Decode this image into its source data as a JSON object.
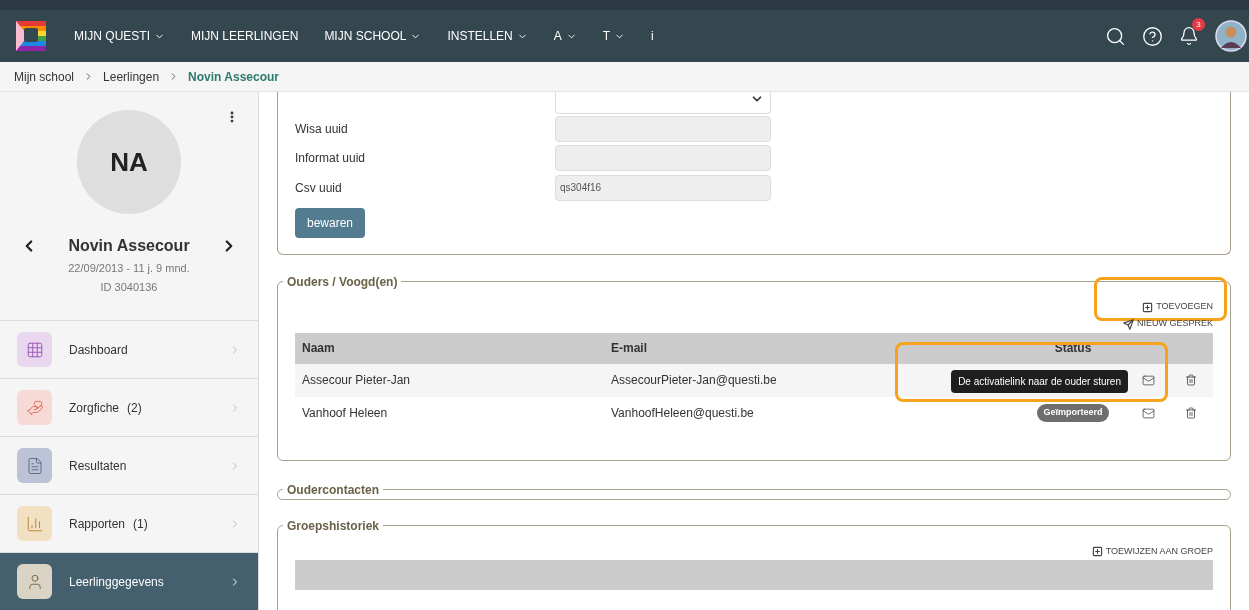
{
  "nav": {
    "items": [
      {
        "label": "MIJN QUESTI",
        "has_menu": true
      },
      {
        "label": "MIJN LEERLINGEN",
        "has_menu": false
      },
      {
        "label": "MIJN SCHOOL",
        "has_menu": true
      },
      {
        "label": "INSTELLEN",
        "has_menu": true
      },
      {
        "label": "A",
        "has_menu": true
      },
      {
        "label": "T",
        "has_menu": true
      },
      {
        "label": "i",
        "has_menu": false
      }
    ],
    "notifications": "3"
  },
  "breadcrumb": [
    {
      "label": "Mijn school",
      "current": false
    },
    {
      "label": "Leerlingen",
      "current": false
    },
    {
      "label": "Novin Assecour",
      "current": true
    }
  ],
  "student": {
    "initials": "NA",
    "name": "Novin Assecour",
    "birth": "22/09/2013 - 11 j. 9 mnd.",
    "id": "ID 3040136"
  },
  "menu": [
    {
      "kind": "dashboard",
      "label": "Dashboard",
      "color": "#e9d6ef",
      "selected": false
    },
    {
      "kind": "care",
      "label": "Zorgfiche",
      "count": "(2)",
      "color": "#f7d9d5",
      "selected": false
    },
    {
      "kind": "results",
      "label": "Resultaten",
      "color": "#bcc3d6",
      "selected": false
    },
    {
      "kind": "reports",
      "label": "Rapporten",
      "count": "(1)",
      "color": "#f2e0c2",
      "selected": false
    },
    {
      "kind": "student",
      "label": "Leerlinggegevens",
      "color": "#d9d4c4",
      "selected": true
    }
  ],
  "form": {
    "fields": [
      {
        "kind": "select"
      },
      {
        "kind": "text",
        "label": "Wisa uuid"
      },
      {
        "kind": "text",
        "label": "Informat uuid"
      },
      {
        "kind": "text",
        "label": "Csv uuid",
        "value": "qs304f16"
      }
    ],
    "save": "bewaren"
  },
  "parents": {
    "title": "Ouders / Voogd(en)",
    "actions": [
      {
        "kind": "add",
        "label": "TOEVOEGEN",
        "highlighted": true
      },
      {
        "kind": "chat",
        "label": "NIEUW GESPREK",
        "highlighted": false
      }
    ],
    "columns": [
      "Naam",
      "E-mail",
      "Status"
    ],
    "rows": [
      {
        "name": "Assecour Pieter-Jan",
        "email": "AssecourPieter-Jan@questi.be",
        "tooltip": "De activatielink naar de ouder sturen",
        "highlighted": true
      },
      {
        "name": "Vanhoof Heleen",
        "email": "VanhoofHeleen@questi.be",
        "status": "Geïmporteerd",
        "highlighted": false
      }
    ]
  },
  "contacts": {
    "title": "Oudercontacten"
  },
  "history": {
    "title": "Groepshistoriek",
    "action": "TOEWIJZEN AAN GROEP"
  }
}
